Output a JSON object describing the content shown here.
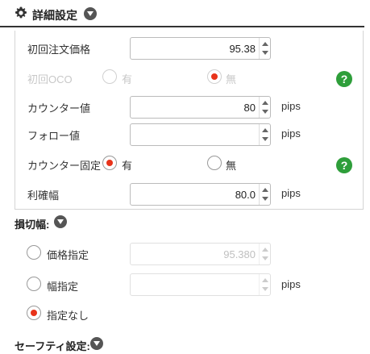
{
  "header": {
    "title": "詳細設定",
    "icon": "gear-icon"
  },
  "rows": {
    "initial_price": {
      "label": "初回注文価格",
      "value": "95.38"
    },
    "initial_oco": {
      "label": "初回OCO",
      "yes": "有",
      "no": "無",
      "selected": "no",
      "disabled": true
    },
    "counter_value": {
      "label": "カウンター値",
      "value": "80",
      "unit": "pips"
    },
    "follow_value": {
      "label": "フォロー値",
      "value": "",
      "unit": "pips"
    },
    "counter_fixed": {
      "label": "カウンター固定",
      "yes": "有",
      "no": "無",
      "selected": "yes"
    },
    "take_profit": {
      "label": "利確幅",
      "value": "80.0",
      "unit": "pips"
    }
  },
  "stop_loss": {
    "title": "損切幅:",
    "options": {
      "price": {
        "label": "価格指定",
        "value": "95.380"
      },
      "width": {
        "label": "幅指定",
        "value": "",
        "unit": "pips"
      },
      "none": {
        "label": "指定なし"
      }
    },
    "selected": "none"
  },
  "safety": {
    "title": "セーフティ設定:"
  },
  "help": {
    "glyph": "?"
  },
  "colors": {
    "accent_radio": "#e8331a",
    "help_green": "#2e9e3a"
  }
}
